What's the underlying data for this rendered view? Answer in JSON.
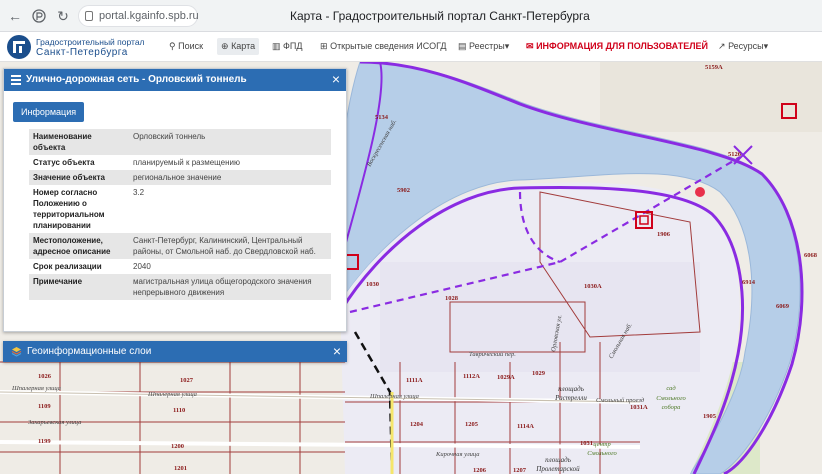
{
  "browser": {
    "url": "portal.kgainfo.spb.ru",
    "title": "Карта - Градостроительный портал Санкт-Петербурга"
  },
  "site": {
    "logo_line1": "Градостроительный портал",
    "logo_line2": "Санкт-Петербурга",
    "menu": {
      "search": "Поиск",
      "map": "Карта",
      "fpd": "ФПД",
      "isogd": "Открытые сведения ИСОГД",
      "registries": "Реестры",
      "info": "ИНФОРМАЦИЯ ДЛЯ ПОЛЬЗОВАТЕЛЕЙ",
      "resources": "Ресурсы"
    }
  },
  "info_panel": {
    "title": "Улично-дорожная сеть - Орловский тоннель",
    "tab": "Информация",
    "rows": [
      {
        "key": "Наименование объекта",
        "value": "Орловский тоннель"
      },
      {
        "key": "Статус объекта",
        "value": "планируемый к размещению"
      },
      {
        "key": "Значение объекта",
        "value": "региональное значение"
      },
      {
        "key": "Номер согласно Положению о территориальном планировании",
        "value": "3.2"
      },
      {
        "key": "Местоположение, адресное описание",
        "value": "Санкт-Петербург, Калининский, Центральный районы, от Смольной наб. до Свердловской наб."
      },
      {
        "key": "Срок реализации",
        "value": "2040"
      },
      {
        "key": "Примечание",
        "value": "магистральная улица общегородского значения непрерывного движения"
      }
    ]
  },
  "layers_panel": {
    "title": "Геоинформационные слои"
  },
  "map": {
    "labels": {
      "p5159a": "5159А",
      "p5134": "5134",
      "p5126": "5126",
      "p5902": "5902",
      "p1906": "1906",
      "p6914": "6914",
      "p6068": "6068",
      "p6069": "6069",
      "p1030a": "1030А",
      "p1028": "1028",
      "p1030": "1030",
      "p1026": "1026",
      "p1027": "1027",
      "p1109": "1109",
      "p1110": "1110",
      "p1111a": "1111А",
      "p1112a": "1112А",
      "p1029a": "1029А",
      "p1029": "1029",
      "p1204": "1204",
      "p1205": "1205",
      "p1114a": "1114А",
      "p1031a": "1031А",
      "p1905": "1905",
      "p1199": "1199",
      "p1200": "1200",
      "p1206": "1206",
      "p1031": "1031",
      "p1201": "1201",
      "p1207": "1207",
      "street_shpalernaya": "Шпалерная улица",
      "street_tavricheskiy": "Таврический пер.",
      "street_orlovskaya": "Орловская ул.",
      "street_zakharyevskaya": "Захарьевская улица",
      "street_kirochnaya": "Кирочная улица",
      "street_voskresenskaya": "Воскресенская наб.",
      "street_smolnogo": "Смольного ул.",
      "street_smolnaya_nab": "Смольная наб.",
      "street_smolny_proezd": "Смольный проезд",
      "square_rastrelli_1": "площадь",
      "square_rastrelli_2": "Растрелли",
      "square_proletarskoy_1": "площадь",
      "square_proletarskoy_2": "Пролетарской",
      "garden_1": "сад",
      "garden_2": "Смольного",
      "garden_3": "собора",
      "center_1": "центр",
      "center_2": "Смольного"
    }
  },
  "colors": {
    "header_blue": "#2c6db3",
    "water": "#b6cee8",
    "route": "#8a2be2",
    "alert": "#d0021b"
  }
}
